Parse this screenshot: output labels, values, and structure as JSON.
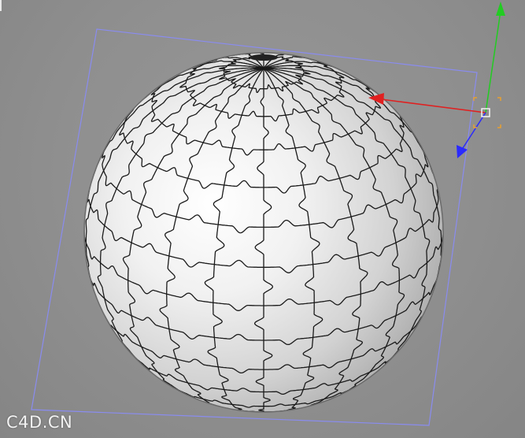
{
  "viewport": {
    "watermark": "C4D.CN",
    "background_color": "#8f8f8f"
  },
  "scene": {
    "object": "puzzle-sphere",
    "plane_outline_color": "#8a8cf0",
    "sphere_color": "#f0f0f0",
    "puzzle_line_color": "#1a1a1a"
  },
  "gizmo": {
    "x_axis_color": "#e02020",
    "y_axis_color": "#22cc22",
    "z_axis_color": "#2a2aff",
    "handle_color": "#e8a030",
    "icons": [
      "move-arrow-x-icon",
      "move-arrow-y-icon",
      "move-arrow-z-icon",
      "object-center-handle-icon"
    ]
  }
}
